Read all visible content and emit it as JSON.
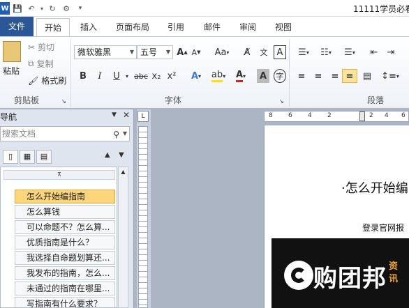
{
  "window": {
    "title": "11111学员必看"
  },
  "qat": {
    "icons": [
      "word-app-icon",
      "save-icon",
      "undo-icon",
      "redo-icon",
      "customize-icon"
    ]
  },
  "tabs": [
    {
      "label": "文件"
    },
    {
      "label": "开始"
    },
    {
      "label": "插入"
    },
    {
      "label": "页面布局"
    },
    {
      "label": "引用"
    },
    {
      "label": "邮件"
    },
    {
      "label": "审阅"
    },
    {
      "label": "视图"
    }
  ],
  "ribbon": {
    "clipboard": {
      "paste": "粘贴",
      "cut": "剪切",
      "copy": "复制",
      "format_painter": "格式刷",
      "label": "剪贴板"
    },
    "font": {
      "family": "微软雅黑",
      "size": "五号",
      "grow": "A",
      "shrink": "A",
      "change_case": "Aa",
      "bold": "B",
      "italic": "I",
      "underline": "U",
      "strike": "abc",
      "subscript": "x₂",
      "superscript": "x²",
      "label": "字体"
    },
    "paragraph": {
      "label": "段落"
    }
  },
  "nav": {
    "title": "导航",
    "search_placeholder": "搜索文档",
    "headings": [
      "怎么开始编指南",
      "怎么算钱",
      "可以命题不？怎么算...",
      "优质指南是什么？",
      "我选择自命题划算还...",
      "我发布的指南，怎么...",
      "未通过的指南在哪里...",
      "写指南有什么要求？"
    ]
  },
  "hruler": {
    "ticks": [
      "8",
      "6",
      "4",
      "2",
      "2",
      "4",
      "6"
    ]
  },
  "document": {
    "heading": "·怎么开始编",
    "text": "登录官网报",
    "banner_text": "购团邦",
    "banner_side": "资讯"
  }
}
